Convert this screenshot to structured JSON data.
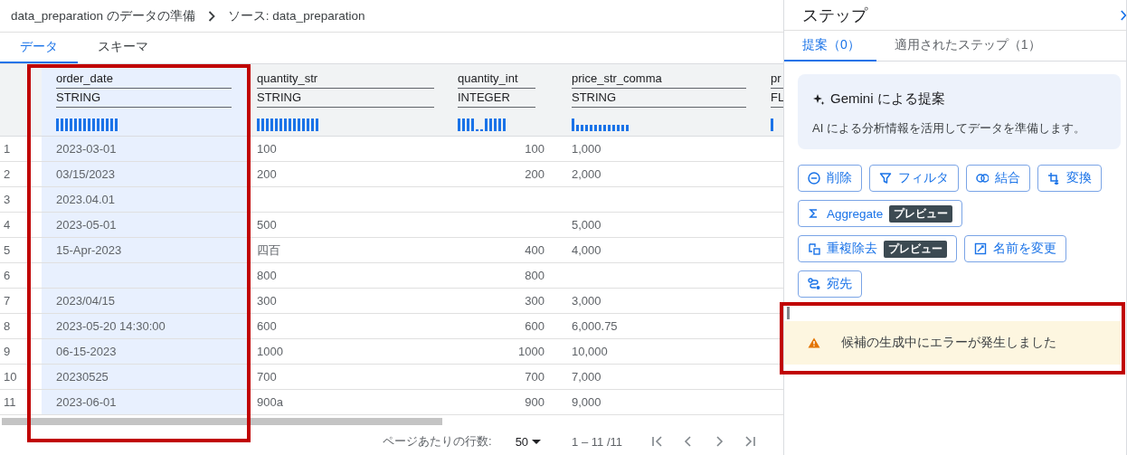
{
  "breadcrumb": {
    "items": [
      "data_preparation のデータの準備",
      "ソース: data_preparation"
    ]
  },
  "view_tabs": [
    {
      "label": "データ",
      "selected": true
    },
    {
      "label": "スキーマ",
      "selected": false
    }
  ],
  "table": {
    "columns": [
      {
        "name": "order_date",
        "type": "STRING",
        "kind": "text",
        "selected": true
      },
      {
        "name": "quantity_str",
        "type": "STRING",
        "kind": "text",
        "selected": false
      },
      {
        "name": "quantity_int",
        "type": "INTEGER",
        "kind": "number",
        "selected": false
      },
      {
        "name": "price_str_comma",
        "type": "STRING",
        "kind": "text",
        "selected": false
      },
      {
        "name": "pr",
        "type": "FL",
        "kind": "text",
        "selected": false
      }
    ],
    "rows": [
      {
        "number": "1",
        "cells": [
          "2023-03-01",
          "100",
          "100",
          "1,000"
        ]
      },
      {
        "number": "2",
        "cells": [
          "03/15/2023",
          "200",
          "200",
          "2,000"
        ]
      },
      {
        "number": "3",
        "cells": [
          "2023.04.01",
          null,
          null,
          null
        ]
      },
      {
        "number": "4",
        "cells": [
          "2023-05-01",
          "500",
          null,
          "5,000"
        ]
      },
      {
        "number": "5",
        "cells": [
          "15-Apr-2023",
          "四百",
          "400",
          "4,000"
        ]
      },
      {
        "number": "6",
        "cells": [
          null,
          "800",
          "800",
          null
        ]
      },
      {
        "number": "7",
        "cells": [
          "2023/04/15",
          "300",
          "300",
          "3,000"
        ]
      },
      {
        "number": "8",
        "cells": [
          "2023-05-20 14:30:00",
          "600",
          "600",
          "6,000.75"
        ]
      },
      {
        "number": "9",
        "cells": [
          "06-15-2023",
          "1000",
          "1000",
          "10,000"
        ]
      },
      {
        "number": "10",
        "cells": [
          "20230525",
          "700",
          "700",
          "7,000"
        ]
      },
      {
        "number": "11",
        "cells": [
          "2023-06-01",
          "900a",
          "900",
          "9,000"
        ]
      }
    ]
  },
  "pager": {
    "rows_per_page_label": "ページあたりの行数:",
    "rows_per_page": "50",
    "range": "1 – 11 /11"
  },
  "steps_panel": {
    "title": "ステップ",
    "tabs": [
      {
        "label": "提案（0）",
        "selected": true
      },
      {
        "label": "適用されたステップ（1）",
        "selected": false
      }
    ],
    "gemini_card": {
      "title": "Gemini による提案",
      "description": "AI による分析情報を活用してデータを準備します。"
    },
    "actions": [
      [
        {
          "label": "削除",
          "kind": "delete"
        },
        {
          "label": "フィルタ",
          "kind": "filter"
        },
        {
          "label": "結合",
          "kind": "join"
        },
        {
          "label": "変換",
          "kind": "transform"
        }
      ],
      [
        {
          "label": "Aggregate",
          "kind": "aggregate",
          "badge": "プレビュー"
        }
      ],
      [
        {
          "label": "重複除去",
          "kind": "dedupe",
          "badge": "プレビュー"
        },
        {
          "label": "名前を変更",
          "kind": "rename"
        }
      ],
      [
        {
          "label": "宛先",
          "kind": "destination"
        }
      ]
    ],
    "error": {
      "message": "候補の生成中にエラーが発生しました"
    }
  }
}
